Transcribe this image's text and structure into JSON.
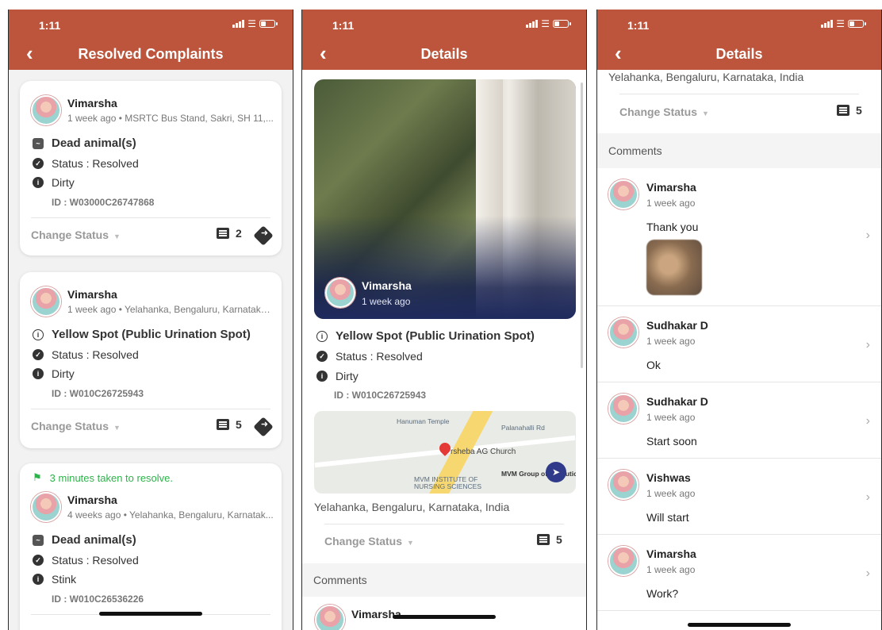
{
  "status_bar": {
    "time": "1:11"
  },
  "screen1": {
    "title": "Resolved Complaints",
    "cards": [
      {
        "user": "Vimarsha",
        "meta": "1 week ago • MSRTC Bus Stand, Sakri, SH 11,...",
        "category": "Dead animal(s)",
        "status": "Status : Resolved",
        "issue": "Dirty",
        "id": "ID : W03000C26747868",
        "change_status": "Change Status",
        "comment_count": "2"
      },
      {
        "user": "Vimarsha",
        "meta": "1 week ago • Yelahanka, Bengaluru, Karnataka,...",
        "category": "Yellow Spot (Public Urination Spot)",
        "status": "Status : Resolved",
        "issue": "Dirty",
        "id": "ID : W010C26725943",
        "change_status": "Change Status",
        "comment_count": "5"
      },
      {
        "resolve_time": "3 minutes taken to resolve.",
        "user": "Vimarsha",
        "meta": "4 weeks ago • Yelahanka, Bengaluru, Karnatak...",
        "category": "Dead animal(s)",
        "status": "Status : Resolved",
        "issue": "Stink",
        "id": "ID : W010C26536226"
      }
    ]
  },
  "screen2": {
    "title": "Details",
    "photo_user": "Vimarsha",
    "photo_meta": "1 week ago",
    "category": "Yellow Spot (Public Urination Spot)",
    "status": "Status : Resolved",
    "issue": "Dirty",
    "id": "ID : W010C26725943",
    "map_labels": [
      "Hanuman Temple",
      "Palanahalli Rd",
      "rsheba AG Church",
      "MVM Group of Institutions",
      "MVM INSTITUTE OF NURSING SCIENCES"
    ],
    "address": "Yelahanka, Bengaluru, Karnataka, India",
    "change_status": "Change Status",
    "comment_count": "5",
    "comments_header": "Comments",
    "first_comment_user": "Vimarsha"
  },
  "screen3": {
    "title": "Details",
    "address": "Yelahanka, Bengaluru, Karnataka, India",
    "change_status": "Change Status",
    "comment_count": "5",
    "comments_header": "Comments",
    "comments": [
      {
        "user": "Vimarsha",
        "time": "1 week ago",
        "text": "Thank you"
      },
      {
        "user": "Sudhakar D",
        "time": "1 week ago",
        "text": "Ok"
      },
      {
        "user": "Sudhakar D",
        "time": "1 week ago",
        "text": "Start soon"
      },
      {
        "user": "Vishwas",
        "time": "1 week ago",
        "text": "Will start"
      },
      {
        "user": "Vimarsha",
        "time": "1 week ago",
        "text": "Work?"
      }
    ]
  },
  "colors": {
    "header": "#bd553c",
    "resolve_green": "#2db34a",
    "text": "#333333"
  },
  "icons": [
    "back-arrow-icon",
    "signal-icon",
    "wifi-icon",
    "battery-icon",
    "check-circle-icon",
    "info-icon",
    "comment-icon",
    "directions-icon",
    "flag-icon",
    "chevron-right-icon",
    "map-pin-icon"
  ]
}
